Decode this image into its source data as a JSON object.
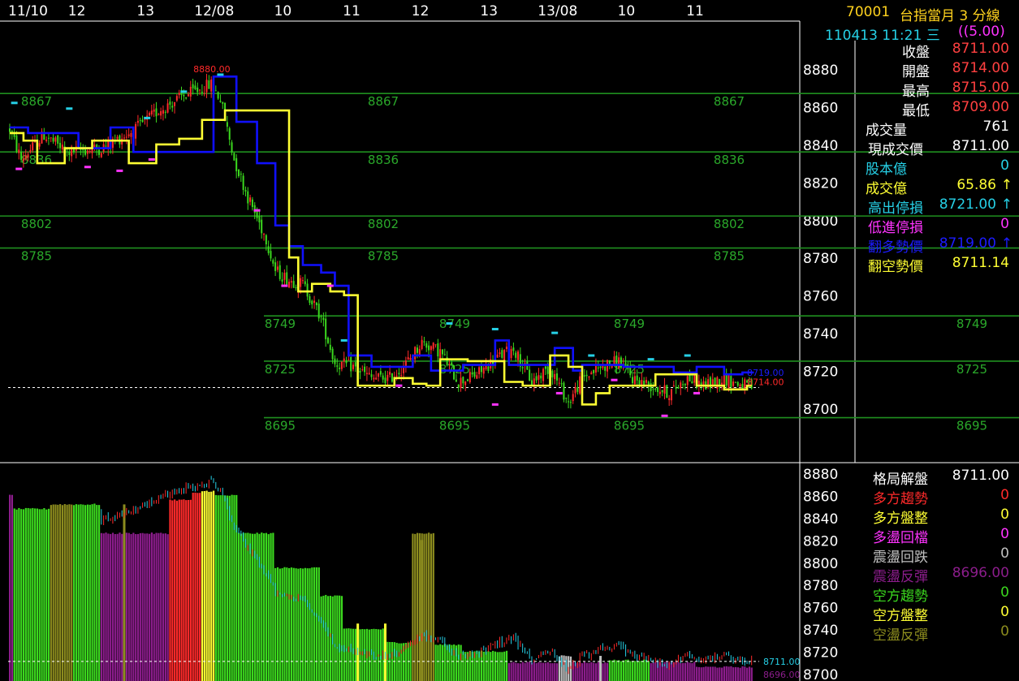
{
  "colors": {
    "grid": "#1f8f1f",
    "up": "#ff2a2a",
    "down": "#3bd81e",
    "blue_line": "#1010ff",
    "yellow_line": "#ffff33",
    "cyan": "#26d0e6",
    "magenta": "#ff33ff",
    "purple": "#8c1d8c",
    "olive": "#8c8c1e",
    "silver": "#c0c0c0",
    "white": "#ffffff",
    "level_label": "#2aa82a"
  },
  "header": {
    "code": "70001",
    "title": "台指當月 3 分線",
    "datetime": "110413 11:21 三",
    "scale": "((5.00)"
  },
  "quote": [
    {
      "label": "收盤",
      "value": "8711.00",
      "label_color": "#ffffff",
      "value_color": "#ff4040"
    },
    {
      "label": "開盤",
      "value": "8714.00",
      "label_color": "#ffffff",
      "value_color": "#ff4040"
    },
    {
      "label": "最高",
      "value": "8715.00",
      "label_color": "#ffffff",
      "value_color": "#ff4040"
    },
    {
      "label": "最低",
      "value": "8709.00",
      "label_color": "#ffffff",
      "value_color": "#ff4040"
    },
    {
      "label": "成交量",
      "value": "761",
      "label_color": "#ffffff",
      "value_color": "#ffffff"
    },
    {
      "label": "現成交價",
      "value": "8711.00",
      "label_color": "#ffffff",
      "value_color": "#ffffff"
    },
    {
      "label": "股本億",
      "value": "0",
      "label_color": "#26d0e6",
      "value_color": "#26d0e6"
    },
    {
      "label": "成交億",
      "value": "65.86",
      "label_color": "#ffff33",
      "value_color": "#ffff33",
      "arrow": "↑",
      "arrow_color": "#ffff33"
    },
    {
      "label": "高出停損",
      "value": "8721.00",
      "label_color": "#26d0e6",
      "value_color": "#26d0e6",
      "arrow": "↑",
      "arrow_color": "#26d0e6"
    },
    {
      "label": "低進停損",
      "value": "0",
      "label_color": "#ff33ff",
      "value_color": "#ff33ff"
    },
    {
      "label": "翻多勢價",
      "value": "8719.00",
      "label_color": "#1c1cff",
      "value_color": "#1c1cff",
      "arrow": "↑",
      "arrow_color": "#1c1cff"
    },
    {
      "label": "翻空勢價",
      "value": "8711.14",
      "label_color": "#ffff33",
      "value_color": "#ffff33"
    }
  ],
  "pattern": [
    {
      "label": "格局解盤",
      "value": "8711.00",
      "label_color": "#ffffff",
      "value_color": "#ffffff"
    },
    {
      "label": "多方趨勢",
      "value": "0",
      "label_color": "#ff2a2a",
      "value_color": "#ff2a2a"
    },
    {
      "label": "多方盤整",
      "value": "0",
      "label_color": "#ffff33",
      "value_color": "#ffff33"
    },
    {
      "label": "多盪回檔",
      "value": "0",
      "label_color": "#ff33ff",
      "value_color": "#ff33ff"
    },
    {
      "label": "震盪回跌",
      "value": "0",
      "label_color": "#c0c0c0",
      "value_color": "#c0c0c0"
    },
    {
      "label": "震盪反彈",
      "value": "8696.00",
      "label_color": "#8c1d8c",
      "value_color": "#8c1d8c"
    },
    {
      "label": "空方趨勢",
      "value": "0",
      "label_color": "#3bd81e",
      "value_color": "#3bd81e"
    },
    {
      "label": "空方盤整",
      "value": "0",
      "label_color": "#ffff33",
      "value_color": "#ffff33"
    },
    {
      "label": "空盪反彈",
      "value": "0",
      "label_color": "#8c8c1e",
      "value_color": "#8c8c1e"
    }
  ],
  "chart_data": [
    {
      "type": "candlestick",
      "x_ticks": [
        {
          "label": "11/10",
          "bar": 0
        },
        {
          "label": "12",
          "bar": 30
        },
        {
          "label": "13",
          "bar": 60
        },
        {
          "label": "12/08",
          "bar": 90
        },
        {
          "label": "10",
          "bar": 120
        },
        {
          "label": "11",
          "bar": 150
        },
        {
          "label": "12",
          "bar": 180
        },
        {
          "label": "13",
          "bar": 210
        },
        {
          "label": "13/08",
          "bar": 240
        },
        {
          "label": "10",
          "bar": 270
        },
        {
          "label": "11",
          "bar": 300
        }
      ],
      "ylim": [
        8690,
        8895
      ],
      "y_ticks": [
        8700,
        8720,
        8740,
        8760,
        8780,
        8800,
        8820,
        8840,
        8860,
        8880
      ],
      "levels": [
        8867,
        8836,
        8802,
        8785,
        8749,
        8725,
        8695
      ],
      "annotations": [
        {
          "text": "8880.00",
          "value": 8880,
          "bar": 88,
          "color": "#ff2a2a"
        },
        {
          "text": "8719.00",
          "value": 8719,
          "bar": 322,
          "color": "#1c1cff"
        },
        {
          "text": "8714.00",
          "value": 8714,
          "bar": 322,
          "color": "#ff2a2a"
        }
      ],
      "last_close": 8711,
      "num_bars": 325,
      "anchors": [
        [
          0,
          8848
        ],
        [
          5,
          8832
        ],
        [
          15,
          8845
        ],
        [
          25,
          8836
        ],
        [
          40,
          8838
        ],
        [
          55,
          8848
        ],
        [
          65,
          8858
        ],
        [
          75,
          8865
        ],
        [
          88,
          8872
        ],
        [
          92,
          8864
        ],
        [
          98,
          8832
        ],
        [
          104,
          8812
        ],
        [
          112,
          8790
        ],
        [
          116,
          8773
        ],
        [
          122,
          8768
        ],
        [
          128,
          8766
        ],
        [
          136,
          8748
        ],
        [
          142,
          8724
        ],
        [
          150,
          8722
        ],
        [
          158,
          8716
        ],
        [
          166,
          8716
        ],
        [
          172,
          8722
        ],
        [
          180,
          8735
        ],
        [
          188,
          8730
        ],
        [
          196,
          8714
        ],
        [
          204,
          8718
        ],
        [
          212,
          8726
        ],
        [
          220,
          8732
        ],
        [
          228,
          8714
        ],
        [
          236,
          8722
        ],
        [
          244,
          8703
        ],
        [
          250,
          8716
        ],
        [
          258,
          8722
        ],
        [
          266,
          8725
        ],
        [
          272,
          8716
        ],
        [
          280,
          8712
        ],
        [
          288,
          8708
        ],
        [
          296,
          8716
        ],
        [
          304,
          8712
        ],
        [
          312,
          8716
        ],
        [
          318,
          8713
        ],
        [
          324,
          8711
        ]
      ],
      "blue_steps": [
        [
          0,
          8849
        ],
        [
          8,
          8846
        ],
        [
          30,
          8838
        ],
        [
          44,
          8849
        ],
        [
          54,
          8836
        ],
        [
          89,
          8876
        ],
        [
          99,
          8852
        ],
        [
          108,
          8830
        ],
        [
          116,
          8797
        ],
        [
          122,
          8786
        ],
        [
          128,
          8776
        ],
        [
          136,
          8772
        ],
        [
          142,
          8765
        ],
        [
          148,
          8728
        ],
        [
          158,
          8722
        ],
        [
          176,
          8728
        ],
        [
          184,
          8720
        ],
        [
          198,
          8723
        ],
        [
          212,
          8736
        ],
        [
          218,
          8723
        ],
        [
          238,
          8732
        ],
        [
          246,
          8720
        ],
        [
          250,
          8723
        ],
        [
          268,
          8722
        ],
        [
          280,
          8722
        ],
        [
          290,
          8719
        ],
        [
          300,
          8722
        ],
        [
          312,
          8718
        ],
        [
          320,
          8719
        ]
      ],
      "yellow_steps": [
        [
          0,
          8846
        ],
        [
          6,
          8842
        ],
        [
          12,
          8830
        ],
        [
          24,
          8838
        ],
        [
          36,
          8842
        ],
        [
          52,
          8830
        ],
        [
          64,
          8840
        ],
        [
          74,
          8843
        ],
        [
          84,
          8853
        ],
        [
          94,
          8858
        ],
        [
          122,
          8780
        ],
        [
          126,
          8762
        ],
        [
          132,
          8766
        ],
        [
          140,
          8762
        ],
        [
          146,
          8760
        ],
        [
          152,
          8712
        ],
        [
          168,
          8716
        ],
        [
          176,
          8713
        ],
        [
          182,
          8712
        ],
        [
          188,
          8726
        ],
        [
          200,
          8725
        ],
        [
          216,
          8714
        ],
        [
          224,
          8712
        ],
        [
          236,
          8728
        ],
        [
          244,
          8722
        ],
        [
          250,
          8702
        ],
        [
          256,
          8708
        ],
        [
          262,
          8712
        ],
        [
          270,
          8712
        ],
        [
          282,
          8718
        ],
        [
          300,
          8712
        ],
        [
          312,
          8710
        ],
        [
          322,
          8712
        ]
      ],
      "cyan_marks": [
        [
          2,
          8862
        ],
        [
          26,
          8859
        ],
        [
          60,
          8854
        ],
        [
          76,
          8868
        ],
        [
          92,
          8877
        ],
        [
          146,
          8736
        ],
        [
          192,
          8745
        ],
        [
          212,
          8742
        ],
        [
          238,
          8740
        ],
        [
          254,
          8728
        ],
        [
          280,
          8726
        ],
        [
          296,
          8728
        ]
      ],
      "magenta_marks": [
        [
          4,
          8827
        ],
        [
          34,
          8828
        ],
        [
          48,
          8826
        ],
        [
          62,
          8832
        ],
        [
          108,
          8805
        ],
        [
          120,
          8765
        ],
        [
          140,
          8765
        ],
        [
          170,
          8712
        ],
        [
          212,
          8702
        ],
        [
          240,
          8708
        ],
        [
          264,
          8715
        ],
        [
          286,
          8696
        ],
        [
          300,
          8708
        ]
      ]
    },
    {
      "type": "bar",
      "ylim": [
        8700,
        8885
      ],
      "y_ticks": [
        8700,
        8720,
        8740,
        8760,
        8780,
        8800,
        8820,
        8840,
        8860,
        8880
      ],
      "annotations": [
        {
          "text": "8711.00",
          "value": 8711,
          "color": "#26d0e6"
        },
        {
          "text": "8696.00",
          "value": 8696,
          "color": "#8c1d8c"
        }
      ],
      "segments": [
        {
          "from": 0,
          "to": 2,
          "color": "purple",
          "value": 8860
        },
        {
          "from": 2,
          "to": 18,
          "color": "green",
          "value": 8848
        },
        {
          "from": 18,
          "to": 28,
          "color": "olive",
          "value": 8852
        },
        {
          "from": 28,
          "to": 40,
          "color": "green",
          "value": 8852
        },
        {
          "from": 40,
          "to": 70,
          "color": "purple",
          "value": 8826
        },
        {
          "from": 70,
          "to": 80,
          "color": "red",
          "value": 8856
        },
        {
          "from": 80,
          "to": 84,
          "color": "red",
          "value": 8862
        },
        {
          "from": 84,
          "to": 90,
          "color": "yellow",
          "value": 8864
        },
        {
          "from": 90,
          "to": 100,
          "color": "green",
          "value": 8860
        },
        {
          "from": 100,
          "to": 116,
          "color": "green",
          "value": 8826
        },
        {
          "from": 116,
          "to": 136,
          "color": "green",
          "value": 8795
        },
        {
          "from": 136,
          "to": 146,
          "color": "green",
          "value": 8770
        },
        {
          "from": 146,
          "to": 164,
          "color": "green",
          "value": 8740
        },
        {
          "from": 164,
          "to": 176,
          "color": "green",
          "value": 8728
        },
        {
          "from": 176,
          "to": 186,
          "color": "olive",
          "value": 8826
        },
        {
          "from": 186,
          "to": 198,
          "color": "green",
          "value": 8726
        },
        {
          "from": 198,
          "to": 218,
          "color": "green",
          "value": 8720
        },
        {
          "from": 218,
          "to": 240,
          "color": "purple",
          "value": 8710
        },
        {
          "from": 240,
          "to": 246,
          "color": "silver",
          "value": 8716
        },
        {
          "from": 246,
          "to": 262,
          "color": "purple",
          "value": 8710
        },
        {
          "from": 262,
          "to": 280,
          "color": "green",
          "value": 8712
        },
        {
          "from": 280,
          "to": 300,
          "color": "purple",
          "value": 8710
        },
        {
          "from": 300,
          "to": 325,
          "color": "purple",
          "value": 8706
        }
      ],
      "extra_bars": [
        {
          "bar": 50,
          "color": "olive",
          "value": 8852
        },
        {
          "bar": 152,
          "color": "yellow",
          "value": 8745
        },
        {
          "bar": 164,
          "color": "yellow",
          "value": 8745
        },
        {
          "bar": 180,
          "color": "olive",
          "value": 8820
        },
        {
          "bar": 258,
          "color": "silver",
          "value": 8716
        }
      ]
    }
  ]
}
